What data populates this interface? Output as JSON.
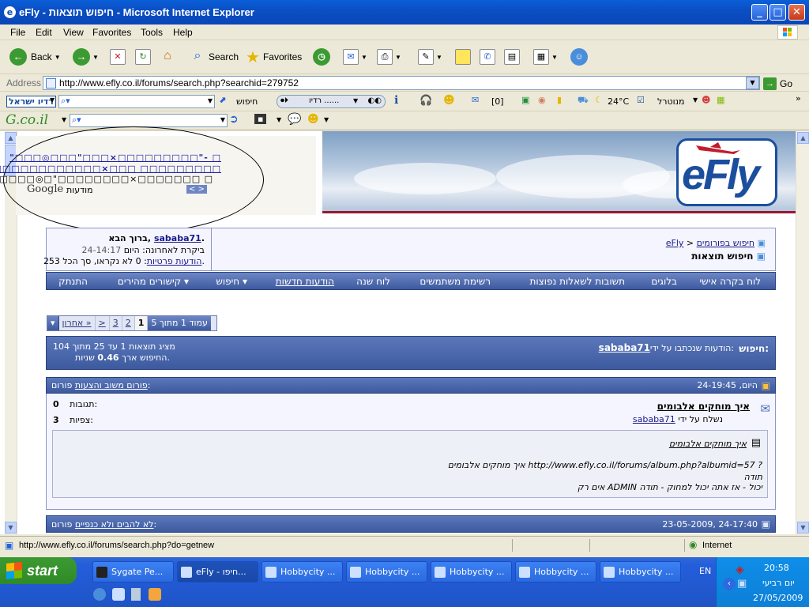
{
  "window": {
    "title": "eFly - חיפוש תוצאות - Microsoft Internet Explorer",
    "min": "_",
    "max": "□",
    "close": "✕"
  },
  "menu": [
    "File",
    "Edit",
    "View",
    "Favorites",
    "Tools",
    "Help"
  ],
  "toolbar": {
    "back": "Back",
    "search": "Search",
    "favorites": "Favorites"
  },
  "address": {
    "label": "Address",
    "url": "http://www.efly.co.il/forums/search.php?searchid=279752",
    "go": "Go"
  },
  "toolbar2": {
    "radio": "רדיו ישראל",
    "search_label": "חיפוש",
    "radio_field": "רדיו ......",
    "mail_count": "[0]",
    "temp": "24°C",
    "monitor": "מנוטרל"
  },
  "toolbar3": {
    "brand": "G.co.il"
  },
  "ad": {
    "line1": "\"□□□◎□□□\"□□□×□□□□□□□□□\"- □",
    "line2": "□□□□□□□□□□□□×□□□ □□□□□□□□□",
    "line3": "□□□□□□□◎□\"□□□□□□□□×□□□□□□□ □",
    "google": "Google",
    "ads_label": "מודעות",
    "nav": "< >"
  },
  "logo": {
    "text": "eFly"
  },
  "welcome": {
    "greeting": "ברוך הבא,",
    "user": "sababa71",
    "last_visit_label": "ביקרת לאחרונה: היום",
    "last_visit_time": "24-14:17",
    "pm_label": "הודעות פרטיות",
    "pm_text": ": 0 לא נקראו, סך הכל 253."
  },
  "breadcrumb": {
    "site": "eFly",
    "sep": ">",
    "section": "חיפוש בפורומים",
    "current": "חיפוש תוצאות"
  },
  "nav": [
    "לוח בקרה אישי",
    "בלוגים",
    "תשובות לשאלות נפוצות",
    "רשימת משתמשים",
    "לוח שנה",
    "הודעות חדשות",
    "חיפוש ▾",
    "קישורים מהירים ▾",
    "התנתק"
  ],
  "pager": {
    "label": "עמוד 1 מתוך 5",
    "pages": [
      "1",
      "2",
      "3"
    ],
    "next": ">",
    "last": "אחרון »",
    "drop": "▾"
  },
  "search_header": {
    "label": "חיפוש:",
    "text": "הודעות שנכתבו על ידי:",
    "user": "sababa71",
    "showing": "מציג תוצאות 1 עד 25 מתוך 104",
    "time": "החיפוש ארך",
    "time_value": "0.46",
    "seconds": "שניות."
  },
  "post1": {
    "date": "היום, 24-19:45",
    "forum_label": "פורום:",
    "forum": "פורום משוב והצעות",
    "title": "איך מוחקים אלבומים",
    "author_prefix": "נשלח על ידי",
    "author": "sababa71",
    "replies_label": "תגובות:",
    "replies": "0",
    "views_label": "צפיות:",
    "views": "3",
    "quote_title": "איך מוחקים אלבומים",
    "quote_line1": "איך מוחקים אלבומים http://www.efly.co.il/forums/album.php?albumid=57 ?",
    "quote_line2": "תודה",
    "quote_line3": "אים רק ADMIN יכול - אז אתה יכול למחוק - תודה"
  },
  "post2": {
    "date": "23-05-2009, 24-17:40",
    "forum_label": "פורום:",
    "forum": "לא להבים ולא כנפיים"
  },
  "status": {
    "url": "http://www.efly.co.il/forums/search.php?do=getnew",
    "zone": "Internet"
  },
  "taskbar": {
    "start": "start",
    "tasks": [
      "Sygate Pe...",
      "eFly - חיפו...",
      "Hobbycity ...",
      "Hobbycity ...",
      "Hobbycity ...",
      "Hobbycity ...",
      "Hobbycity ..."
    ],
    "lang": "EN",
    "time": "20:58",
    "day": "יום רביעי",
    "date": "27/05/2009"
  },
  "colors": {
    "title_blue": "#0b4fc4",
    "nav_blue": "#3d5a9f",
    "link": "#1a1a8a",
    "start_green": "#3c9a32"
  }
}
